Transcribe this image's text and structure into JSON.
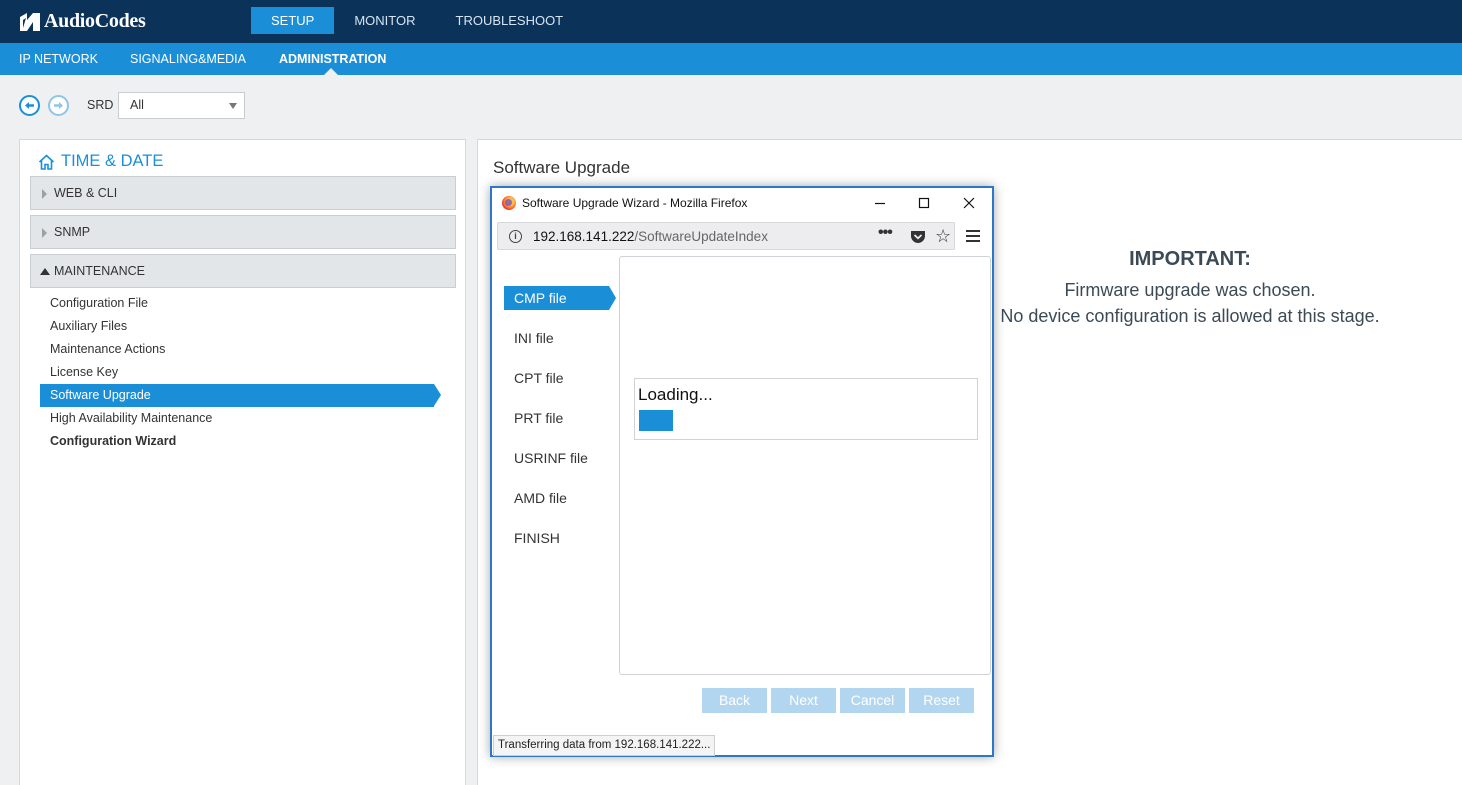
{
  "header": {
    "brand": "AudioCodes",
    "top_nav": [
      {
        "label": "SETUP",
        "active": true
      },
      {
        "label": "MONITOR",
        "active": false
      },
      {
        "label": "TROUBLESHOOT",
        "active": false
      }
    ],
    "sub_nav": [
      {
        "label": "IP NETWORK",
        "active": false
      },
      {
        "label": "SIGNALING&MEDIA",
        "active": false
      },
      {
        "label": "ADMINISTRATION",
        "active": true
      }
    ]
  },
  "toolbar": {
    "srd_label": "SRD",
    "srd_value": "All"
  },
  "left_panel": {
    "title": "TIME & DATE",
    "sections": [
      {
        "label": "WEB & CLI",
        "expanded": false
      },
      {
        "label": "SNMP",
        "expanded": false
      },
      {
        "label": "MAINTENANCE",
        "expanded": true
      }
    ],
    "items": [
      {
        "label": "Configuration File"
      },
      {
        "label": "Auxiliary Files"
      },
      {
        "label": "Maintenance Actions"
      },
      {
        "label": "License Key"
      },
      {
        "label": "Software Upgrade",
        "active": true
      },
      {
        "label": "High Availability Maintenance"
      },
      {
        "label": "Configuration Wizard",
        "bold": true
      }
    ]
  },
  "main": {
    "title": "Software Upgrade",
    "important_heading": "IMPORTANT:",
    "important_line1": "Firmware upgrade was chosen.",
    "important_line2": "No device configuration is allowed at this stage."
  },
  "popup": {
    "window_title": "Software Upgrade Wizard - Mozilla Firefox",
    "url_host": "192.168.141.222",
    "url_path": "/SoftwareUpdateIndex",
    "steps": [
      "CMP file",
      "INI file",
      "CPT file",
      "PRT file",
      "USRINF file",
      "AMD file",
      "FINISH"
    ],
    "active_step": 0,
    "loading_text": "Loading...",
    "buttons": {
      "back": "Back",
      "next": "Next",
      "cancel": "Cancel",
      "reset": "Reset"
    },
    "status_text": "Transferring data from 192.168.141.222..."
  },
  "colors": {
    "top_bar": "#0b3359",
    "accent": "#1a8fd8",
    "disabled_button": "#b3d6f0"
  }
}
